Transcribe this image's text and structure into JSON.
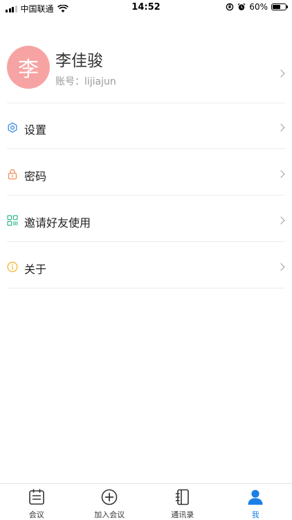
{
  "status_bar": {
    "carrier": "中国联通",
    "time": "14:52",
    "battery": "60%",
    "battery_level": 0.6
  },
  "profile": {
    "avatar_char": "李",
    "name": "李佳骏",
    "account": "账号：lijiajun"
  },
  "menu": {
    "items": [
      {
        "label": "设置",
        "icon": "gear-hexagon-icon",
        "color": "#3a8ee6"
      },
      {
        "label": "密码",
        "icon": "lock-icon",
        "color": "#f08c5a"
      },
      {
        "label": "邀请好友使用",
        "icon": "qrcode-icon",
        "color": "#2fb98a"
      },
      {
        "label": "关于",
        "icon": "info-icon",
        "color": "#f0b429"
      }
    ]
  },
  "tabs": [
    {
      "label": "会议",
      "icon": "calendar-icon"
    },
    {
      "label": "加入会议",
      "icon": "plus-circle-icon"
    },
    {
      "label": "通讯录",
      "icon": "contacts-book-icon"
    },
    {
      "label": "我",
      "icon": "person-icon",
      "active": true
    }
  ],
  "colors": {
    "accent": "#1a7fe6",
    "avatar_bg": "#f7a3a3"
  }
}
